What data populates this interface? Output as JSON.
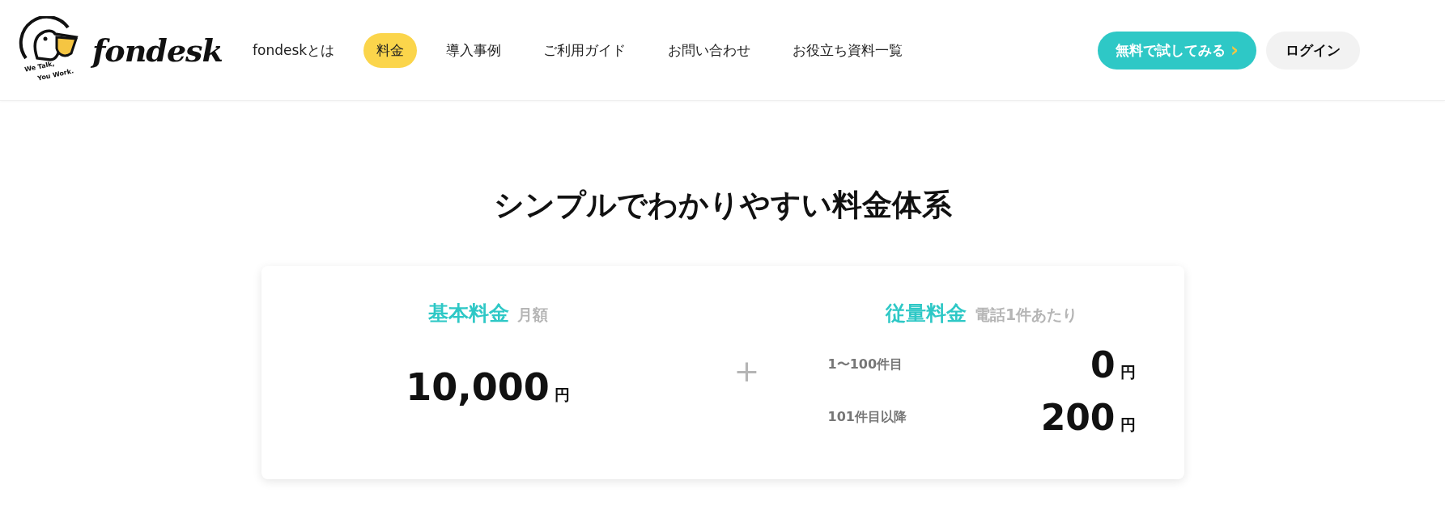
{
  "header": {
    "logo": {
      "wordmark": "fondesk",
      "tagline_1": "We Talk,",
      "tagline_2": "You Work."
    },
    "nav": [
      {
        "label": "fondeskとは",
        "selected": false
      },
      {
        "label": "料金",
        "selected": true
      },
      {
        "label": "導入事例",
        "selected": false
      },
      {
        "label": "ご利用ガイド",
        "selected": false
      },
      {
        "label": "お問い合わせ",
        "selected": false
      },
      {
        "label": "お役立ち資料一覧",
        "selected": false
      }
    ],
    "trial_button": {
      "label": "無料で試してみる",
      "chevron": "›"
    },
    "login_button": {
      "label": "ログイン"
    }
  },
  "pricing": {
    "title": "シンプルでわかりやすい料金体系",
    "base": {
      "title": "基本料金",
      "note": "月額",
      "amount": "10,000",
      "unit": "円"
    },
    "plus": "+",
    "usage": {
      "title": "従量料金",
      "note": "電話1件あたり",
      "tiers": [
        {
          "range": "1〜100件目",
          "amount": "0",
          "unit": "円"
        },
        {
          "range": "101件目以降",
          "amount": "200",
          "unit": "円"
        }
      ]
    }
  }
}
